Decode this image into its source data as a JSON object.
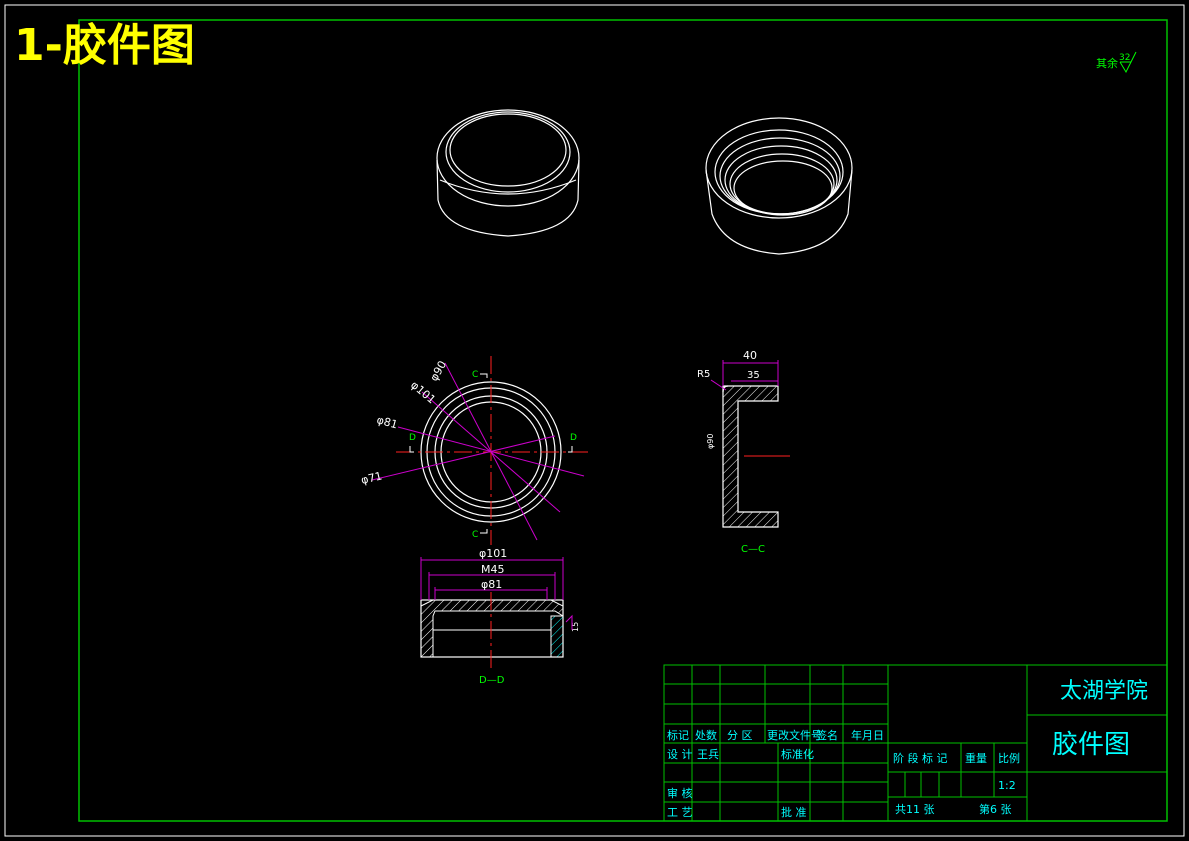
{
  "sheet": {
    "title": "1-胶件图",
    "roughness_note": "其余",
    "roughness_value": "32"
  },
  "views": {
    "front": {
      "dim_d101": "φ101",
      "dim_d90": "φ90",
      "dim_d81": "φ81",
      "dim_d71": "φ71",
      "section_c": "C",
      "section_d": "D"
    },
    "section_cc": {
      "label": "C—C",
      "dim_40": "40",
      "dim_35": "35",
      "dim_r5": "R5",
      "dim_side": "φ90"
    },
    "section_dd": {
      "label": "D—D",
      "dim_d101": "φ101",
      "dim_m45": "M45",
      "dim_d81": "φ81",
      "dim_side": "15"
    }
  },
  "title_block": {
    "school": "太湖学院",
    "drawing_name": "胶件图",
    "rev_headers": [
      "标记",
      "处数",
      "分 区",
      "更改文件号",
      "签名",
      "年月日"
    ],
    "design_label": "设 计",
    "designer": "王兵",
    "standard_label": "标准化",
    "review_label": "审 核",
    "process_label": "工 艺",
    "approve_label": "批 准",
    "stage_label": "阶 段 标 记",
    "weight_label": "重量",
    "scale_label": "比例",
    "scale_value": "1:2",
    "total_sheets": "共11 张",
    "sheet_no": "第6 张"
  },
  "colors": {
    "border": "#00c000",
    "outline": "#ffffff",
    "dimension": "#cc00cc",
    "text": "#00ffff",
    "center": "#ff2020",
    "title": "#ffff00",
    "section_label": "#00ff00"
  }
}
